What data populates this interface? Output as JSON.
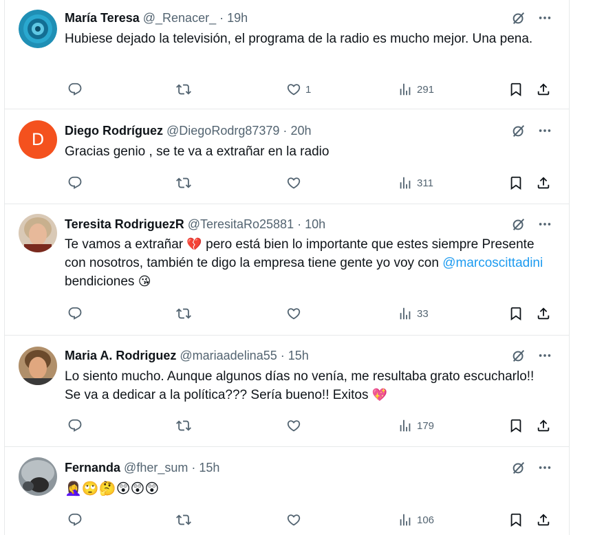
{
  "colors": {
    "text": "#0f1419",
    "muted": "#536471",
    "link": "#1d9bf0",
    "border": "#e7e9ea",
    "avatar_d": "#f4511e"
  },
  "icons": [
    "grok-icon",
    "more-icon",
    "reply-icon",
    "retweet-icon",
    "like-icon",
    "views-icon",
    "bookmark-icon",
    "share-icon"
  ],
  "tweets": [
    {
      "name": "María Teresa",
      "handle": "@_Renacer_",
      "dot": "·",
      "time": "19h",
      "text": "Hubiese dejado la televisión, el programa de la radio es mucho mejor. Una pena.",
      "replies": "",
      "retweets": "",
      "likes": "1",
      "views": "291"
    },
    {
      "name": "Diego Rodríguez",
      "handle": "@DiegoRodrg87379",
      "dot": "·",
      "time": "20h",
      "avatar_letter": "D",
      "text": "Gracias genio , se te va a extrañar en la radio",
      "replies": "",
      "retweets": "",
      "likes": "",
      "views": "311"
    },
    {
      "name": "Teresita RodriguezR",
      "handle": "@TeresitaRo25881",
      "dot": "·",
      "time": "10h",
      "text_a": "Te vamos a extrañar ",
      "emoji_a": "💔",
      "text_b": " pero está bien lo  importante que estes siempre Presente con nosotros, también te digo la empresa tiene gente yo voy con ",
      "mention": "@marcoscittadini",
      "text_c": " bendiciones ",
      "emoji_c": "😘",
      "replies": "",
      "retweets": "",
      "likes": "",
      "views": "33"
    },
    {
      "name": "Maria A. Rodriguez",
      "handle": "@mariaadelina55",
      "dot": "·",
      "time": "15h",
      "text": "Lo siento mucho. Aunque algunos días no venía, me resultaba grato escucharlo!! Se va a dedicar a la política??? Sería bueno!! Exitos ",
      "emoji": "💖",
      "replies": "",
      "retweets": "",
      "likes": "",
      "views": "179"
    },
    {
      "name": "Fernanda",
      "handle": "@fher_sum",
      "dot": "·",
      "time": "15h",
      "emojis": "🤦‍♀️🙄🤔😲😲😲",
      "replies": "",
      "retweets": "",
      "likes": "",
      "views": "106"
    }
  ]
}
